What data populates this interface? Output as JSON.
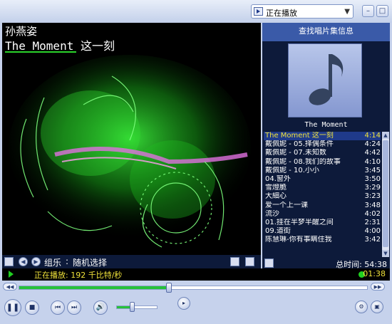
{
  "header": {
    "now_playing_select": "正在播放",
    "dropdown_arrow": "▼",
    "minimize": "–",
    "maximize": "□",
    "close": "×"
  },
  "video": {
    "artist": "孙燕姿",
    "title": "The Moment 这一刻"
  },
  "video_bar": {
    "group_label": "组乐",
    "separator": ":",
    "random_label": "随机选择"
  },
  "right_panel": {
    "find_album_info": "查找唱片集信息",
    "album_caption": "The Moment",
    "playlist": [
      {
        "title": "The Moment 这一刻",
        "duration": "4:14",
        "active": true
      },
      {
        "title": "戴佩妮 - 05.择偶条件",
        "duration": "4:24"
      },
      {
        "title": "戴佩妮 - 07.未知数",
        "duration": "4:42"
      },
      {
        "title": "戴佩妮 - 08.我们的故事",
        "duration": "4:10"
      },
      {
        "title": "戴佩妮 - 10.小小",
        "duration": "3:45"
      },
      {
        "title": "04.窗外",
        "duration": "3:50"
      },
      {
        "title": "雪燈脆",
        "duration": "3:29"
      },
      {
        "title": "大細心",
        "duration": "3:23"
      },
      {
        "title": "爱一个上一课",
        "duration": "3:48"
      },
      {
        "title": "流沙",
        "duration": "4:02"
      },
      {
        "title": "01.挂在半梦半醒之间",
        "duration": "2:31"
      },
      {
        "title": "09.道街",
        "duration": "4:00"
      },
      {
        "title": "陈慧琳-你有事瞒住我",
        "duration": "3:42"
      }
    ],
    "total_time": "总时间: 54:38"
  },
  "status": {
    "text": "正在播放: 192 千比特/秒",
    "elapsed": "01:38"
  },
  "seek": {
    "progress": 0.43,
    "left_btn": "◀◀",
    "right_btn": "▶▶"
  },
  "controls": {
    "volume": 0.38
  },
  "colors": {
    "accent_green": "#26c23a",
    "status_yellow": "#f0e23a",
    "panel_dark": "#0d1a3a"
  }
}
